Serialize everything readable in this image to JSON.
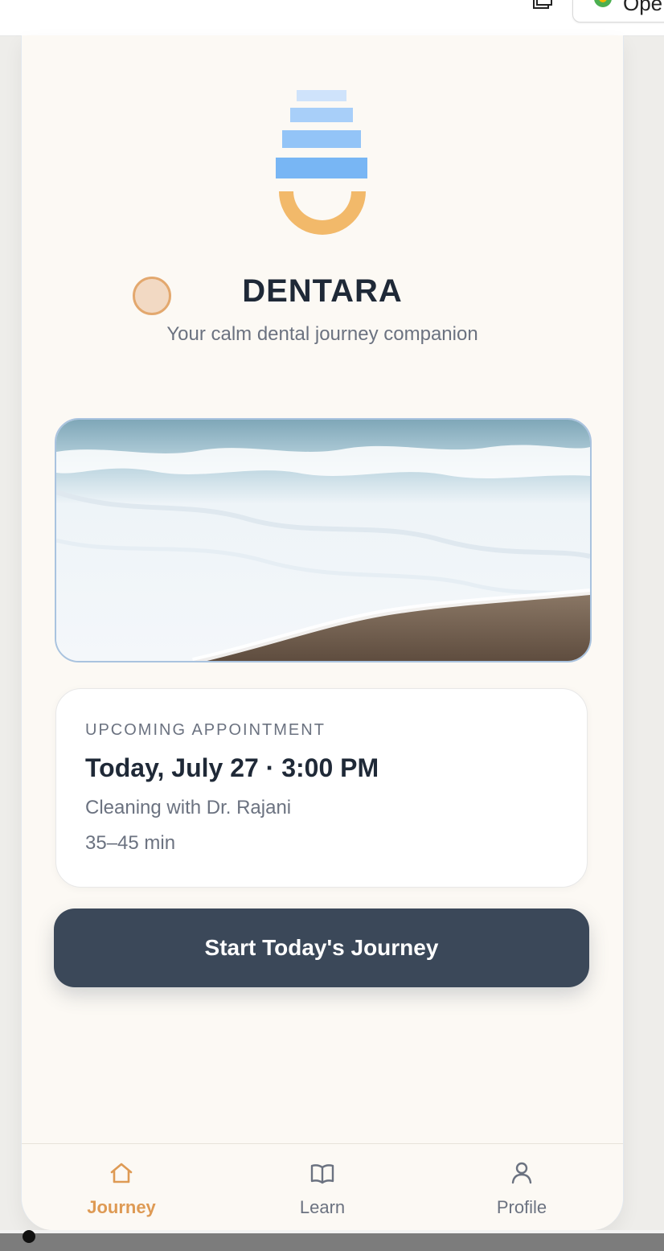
{
  "browser": {
    "tab_label_partial": "Ope"
  },
  "app": {
    "brand_title": "DENTARA",
    "brand_subtitle": "Your calm dental journey companion",
    "colors": {
      "accent": "#de9a54",
      "primary_dark": "#3b4859",
      "logo_blue_light": "#cfe3fb",
      "logo_blue_mid": "#a8cff9",
      "logo_blue": "#93c4f7",
      "logo_blue_strong": "#78b6f4",
      "logo_orange": "#f2b96a"
    }
  },
  "appointment": {
    "kicker": "UPCOMING APPOINTMENT",
    "title": "Today, July 27 · 3:00 PM",
    "detail": "Cleaning with Dr. Rajani",
    "duration": "35–45 min"
  },
  "cta": {
    "label": "Start Today's Journey"
  },
  "nav": {
    "items": [
      {
        "label": "Journey",
        "icon": "home-icon",
        "active": true
      },
      {
        "label": "Learn",
        "icon": "book-icon",
        "active": false
      },
      {
        "label": "Profile",
        "icon": "user-icon",
        "active": false
      }
    ]
  }
}
